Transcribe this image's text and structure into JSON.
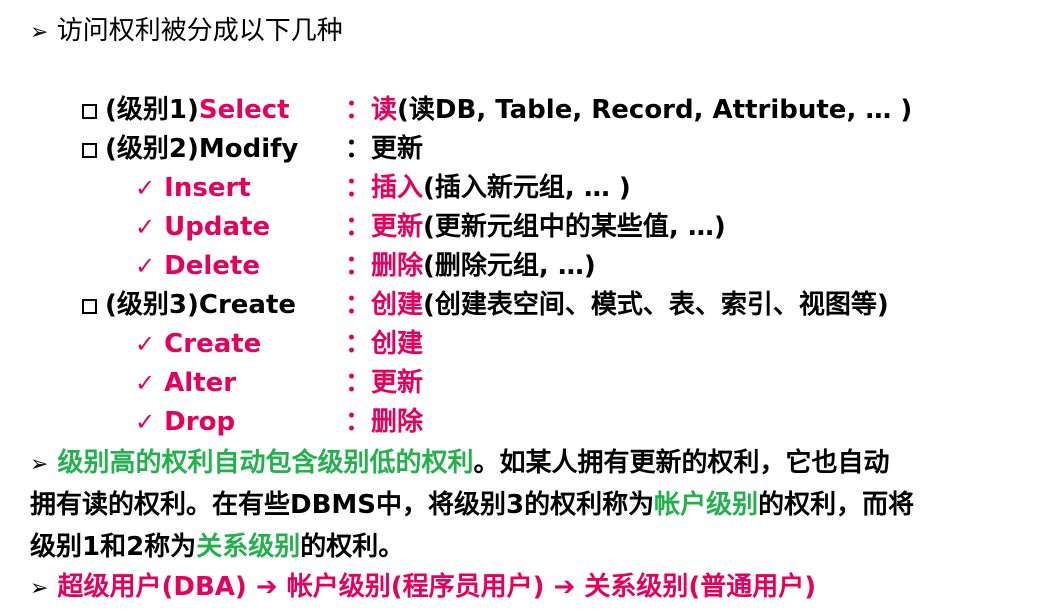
{
  "colors": {
    "accent": "#e6005c",
    "green": "#22b14c",
    "text": "#000000"
  },
  "title": {
    "icon": "arrow-bullet-icon",
    "text": "访问权利被分成以下几种"
  },
  "rows": [
    {
      "kind": "level",
      "left": "(级别1)",
      "leftPink": "Select",
      "colon": "：",
      "pink": "读",
      "rest": "(读DB, Table, Record, Attribute, … )"
    },
    {
      "kind": "level",
      "left": "(级别2)Modify",
      "leftPink": "",
      "colon": "：",
      "pink": "",
      "rest": "更新"
    },
    {
      "kind": "check",
      "check": "✓",
      "label": "Insert",
      "colon": "：",
      "pink": "插入",
      "rest": "(插入新元组, … )"
    },
    {
      "kind": "check",
      "check": "✓",
      "label": "Update",
      "colon": "：",
      "pink": "更新",
      "rest": "(更新元组中的某些值, …)"
    },
    {
      "kind": "check",
      "check": "✓",
      "label": "Delete",
      "colon": "：",
      "pink": "删除",
      "rest": "(删除元组, …)"
    },
    {
      "kind": "level",
      "left": "(级别3)Create",
      "leftPink": "",
      "colon": "：",
      "pink": "创建",
      "rest": "(创建表空间、模式、表、索引、视图等)"
    },
    {
      "kind": "check",
      "check": "✓",
      "label": "Create",
      "colon": "：",
      "pink": "创建",
      "rest": ""
    },
    {
      "kind": "check",
      "check": "✓",
      "label": "Alter",
      "colon": "：",
      "pink": "更新",
      "rest": ""
    },
    {
      "kind": "check",
      "check": "✓",
      "label": "Drop",
      "colon": "：",
      "pink": "删除",
      "rest": ""
    }
  ],
  "para1": {
    "green1": "级别高的权利自动包含级别低的权利",
    "t1": "。如某人拥有更新的权利，它也自动",
    "t2": "拥有读的权利。在有些DBMS中，将级别3的权利称为",
    "green2": "帐户级别",
    "t3": "的权利，而将",
    "t4": "级别1和2称为",
    "green3": "关系级别",
    "t5": "的权利。"
  },
  "para2": {
    "a": "超级用户(DBA)",
    "arrow1": "➔",
    "b": "帐户级别(程序员用户)",
    "arrow2": "➔",
    "c": "关系级别(普通用户)"
  }
}
